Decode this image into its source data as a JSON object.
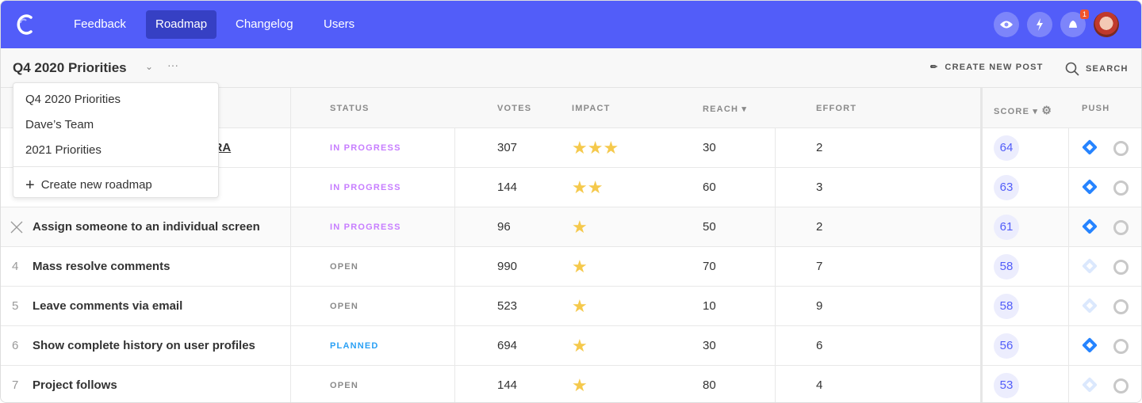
{
  "nav": {
    "items": [
      {
        "label": "Feedback"
      },
      {
        "label": "Roadmap",
        "active": true
      },
      {
        "label": "Changelog"
      },
      {
        "label": "Users"
      }
    ],
    "notification_count": "1",
    "icons": [
      "eye-icon",
      "bolt-icon",
      "bell-icon"
    ]
  },
  "toolbar": {
    "roadmap_title": "Q4 2020 Priorities",
    "more": "···",
    "create_post": "CREATE NEW POST",
    "search": "SEARCH"
  },
  "dropdown": {
    "items": [
      "Q4 2020 Priorities",
      "Dave’s Team",
      "2021 Priorities"
    ],
    "create": "Create new roadmap"
  },
  "table": {
    "headers": {
      "status": "STATUS",
      "votes": "VOTES",
      "impact": "IMPACT",
      "reach": "REACH",
      "effort": "EFFORT",
      "score": "SCORE",
      "push": "PUSH"
    },
    "rows": [
      {
        "num": "",
        "title": "JIRA",
        "status": "IN PROGRESS",
        "votes": "307",
        "impact": 3,
        "reach": "30",
        "effort": "2",
        "score": "64",
        "jira_active": true
      },
      {
        "num": "",
        "title": "",
        "status": "IN PROGRESS",
        "votes": "144",
        "impact": 2,
        "reach": "60",
        "effort": "3",
        "score": "63",
        "jira_active": true
      },
      {
        "num": "",
        "title": "Assign someone to an individual screen",
        "status": "IN PROGRESS",
        "votes": "96",
        "impact": 1,
        "reach": "50",
        "effort": "2",
        "score": "61",
        "jira_active": true
      },
      {
        "num": "4",
        "title": "Mass resolve comments",
        "status": "OPEN",
        "votes": "990",
        "impact": 1,
        "reach": "70",
        "effort": "7",
        "score": "58",
        "jira_active": false
      },
      {
        "num": "5",
        "title": "Leave comments via email",
        "status": "OPEN",
        "votes": "523",
        "impact": 1,
        "reach": "10",
        "effort": "9",
        "score": "58",
        "jira_active": false
      },
      {
        "num": "6",
        "title": "Show complete history on user profiles",
        "status": "PLANNED",
        "votes": "694",
        "impact": 1,
        "reach": "30",
        "effort": "6",
        "score": "56",
        "jira_active": true
      },
      {
        "num": "7",
        "title": "Project follows",
        "status": "OPEN",
        "votes": "144",
        "impact": 1,
        "reach": "80",
        "effort": "4",
        "score": "53",
        "jira_active": false
      }
    ]
  },
  "colors": {
    "brand": "#525df9",
    "in_progress": "#c77dff",
    "open": "#8a8a8a",
    "planned": "#2aa0f5",
    "star": "#f5c94c"
  }
}
